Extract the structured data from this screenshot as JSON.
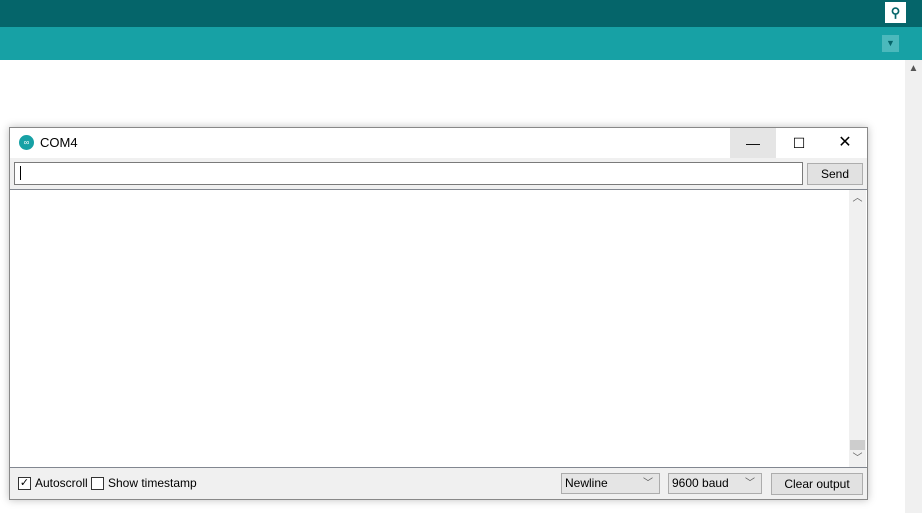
{
  "ide": {
    "serial_monitor_icon": "serial-monitor-icon",
    "tab_menu_icon": "triangle-down-icon"
  },
  "window": {
    "title": "COM4",
    "logo_icon": "arduino-infinity-icon",
    "minimize": "—",
    "maximize": "☐",
    "close": "✕"
  },
  "input": {
    "value": "",
    "placeholder": ""
  },
  "send_label": "Send",
  "output": {
    "text": ""
  },
  "footer": {
    "autoscroll_label": "Autoscroll",
    "autoscroll_checked": true,
    "timestamp_label": "Show timestamp",
    "timestamp_checked": false,
    "line_ending": "Newline",
    "baud": "9600 baud",
    "clear_label": "Clear output"
  },
  "colors": {
    "header_dark": "#05656a",
    "header_teal": "#17a1a5"
  }
}
